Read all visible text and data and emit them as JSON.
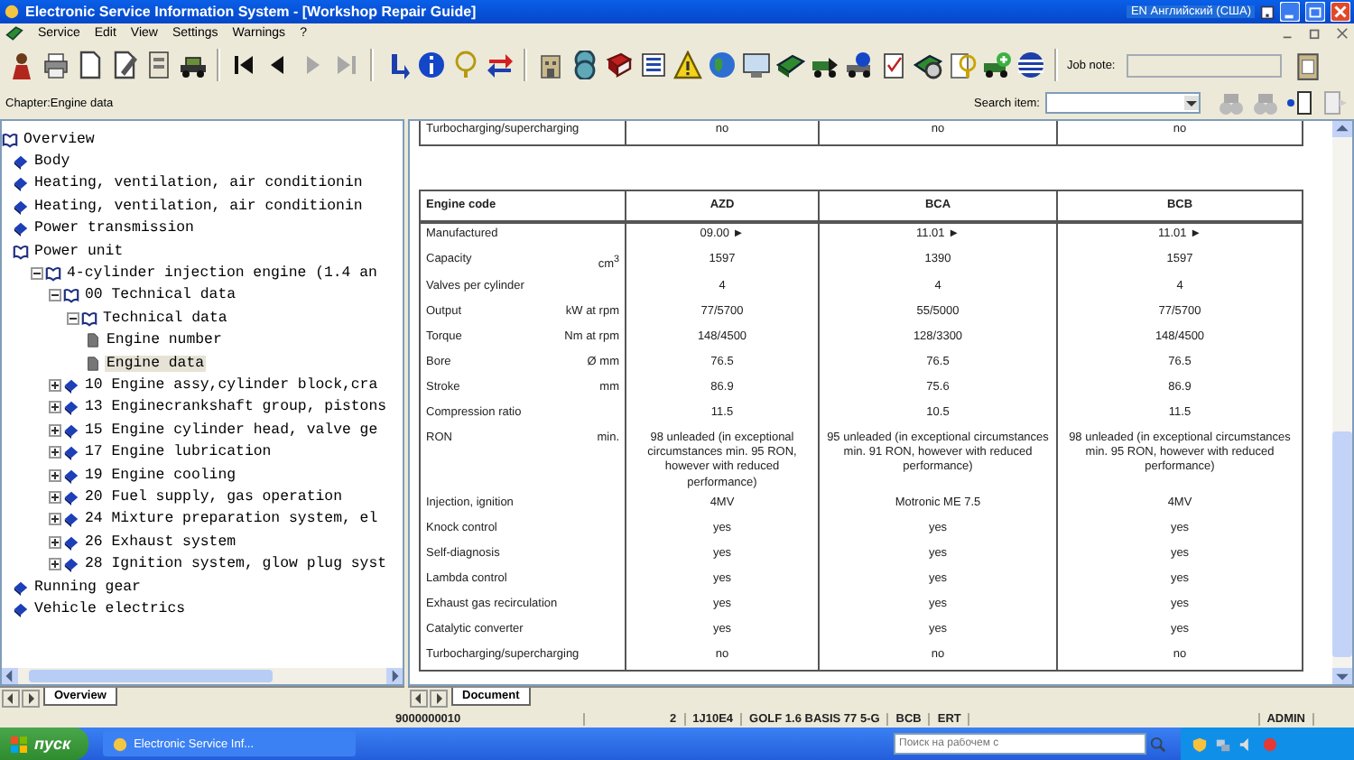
{
  "window": {
    "title": "Electronic Service Information System - [Workshop Repair Guide]",
    "language": "EN Английский (США)"
  },
  "menu": [
    "Service",
    "Edit",
    "View",
    "Settings",
    "Warnings",
    "?"
  ],
  "job_note": {
    "label": "Job note:"
  },
  "chapter": "Chapter:Engine data",
  "search": {
    "label": "Search item:"
  },
  "tree": [
    {
      "label": "Overview",
      "kind": "book",
      "expanded": true,
      "selected": false,
      "children": [
        {
          "label": "Body",
          "kind": "book",
          "selected": false
        },
        {
          "label": "Heating, ventilation, air conditionin",
          "kind": "book",
          "selected": false
        },
        {
          "label": "Heating, ventilation, air conditionin",
          "kind": "book",
          "selected": false
        },
        {
          "label": "Power transmission",
          "kind": "book",
          "selected": false
        },
        {
          "label": "Power unit",
          "kind": "book",
          "expanded": true,
          "selected": false,
          "children": [
            {
              "label": "4-cylinder injection engine (1.4 an",
              "kind": "book",
              "expanded": true,
              "selected": false,
              "children": [
                {
                  "label": "00 Technical data",
                  "kind": "book",
                  "expanded": true,
                  "selected": false,
                  "children": [
                    {
                      "label": "Technical data",
                      "kind": "book",
                      "expanded": true,
                      "selected": false,
                      "children": [
                        {
                          "label": "Engine number",
                          "kind": "page",
                          "selected": false
                        },
                        {
                          "label": "Engine data",
                          "kind": "page",
                          "selected": true
                        }
                      ]
                    }
                  ]
                },
                {
                  "label": "10 Engine assy,cylinder block,cra",
                  "kind": "book",
                  "expanded": false,
                  "selected": false
                },
                {
                  "label": "13 Enginecrankshaft group, pistons",
                  "kind": "book",
                  "expanded": false,
                  "selected": false
                },
                {
                  "label": "15 Engine cylinder head, valve ge",
                  "kind": "book",
                  "expanded": false,
                  "selected": false
                },
                {
                  "label": "17 Engine lubrication",
                  "kind": "book",
                  "expanded": false,
                  "selected": false
                },
                {
                  "label": "19 Engine cooling",
                  "kind": "book",
                  "expanded": false,
                  "selected": false
                },
                {
                  "label": "20 Fuel supply, gas operation",
                  "kind": "book",
                  "expanded": false,
                  "selected": false
                },
                {
                  "label": "24 Mixture preparation system, el",
                  "kind": "book",
                  "expanded": false,
                  "selected": false
                },
                {
                  "label": "26 Exhaust system",
                  "kind": "book",
                  "expanded": false,
                  "selected": false
                },
                {
                  "label": "28 Ignition system, glow plug syst",
                  "kind": "book",
                  "expanded": false,
                  "selected": false
                }
              ]
            }
          ]
        },
        {
          "label": "Running gear",
          "kind": "book",
          "selected": false
        },
        {
          "label": "Vehicle electrics",
          "kind": "book",
          "selected": false
        }
      ]
    }
  ],
  "previous_table_rows": [
    {
      "label": "Turbocharging/supercharging",
      "values": [
        "no",
        "no",
        "no"
      ]
    }
  ],
  "engine_table": {
    "columns": [
      "Engine code",
      "AZD",
      "BCA",
      "BCB"
    ],
    "rows": [
      {
        "label": "Manufactured",
        "values": [
          "09.00 ►",
          "11.01 ►",
          "11.01 ►"
        ]
      },
      {
        "label": "Capacity",
        "unit": "cm$^{3}$",
        "values": [
          "1597",
          "1390",
          "1597"
        ]
      },
      {
        "label": "Valves per cylinder",
        "values": [
          "4",
          "4",
          "4"
        ]
      },
      {
        "label": "Output",
        "unit": "kW at rpm",
        "values": [
          "77/5700",
          "55/5000",
          "77/5700"
        ]
      },
      {
        "label": "Torque",
        "unit": "Nm at rpm",
        "values": [
          "148/4500",
          "128/3300",
          "148/4500"
        ]
      },
      {
        "label": "Bore",
        "unit": "Ø mm",
        "values": [
          "76.5",
          "76.5",
          "76.5"
        ]
      },
      {
        "label": "Stroke",
        "unit": "mm",
        "values": [
          "86.9",
          "75.6",
          "86.9"
        ]
      },
      {
        "label": "Compression ratio",
        "values": [
          "11.5",
          "10.5",
          "11.5"
        ]
      },
      {
        "label": "RON",
        "unit": "min.",
        "values": [
          "98 unleaded (in exceptional circumstances min. 95 RON, however with reduced performance)",
          "95 unleaded (in exceptional circumstances min. 91 RON, however with reduced performance)",
          "98 unleaded (in exceptional circumstances min. 95 RON, however with reduced performance)"
        ]
      },
      {
        "label": "Injection, ignition",
        "values": [
          "4MV",
          "Motronic ME 7.5",
          "4MV"
        ]
      },
      {
        "label": "Knock control",
        "values": [
          "yes",
          "yes",
          "yes"
        ]
      },
      {
        "label": "Self-diagnosis",
        "values": [
          "yes",
          "yes",
          "yes"
        ]
      },
      {
        "label": "Lambda control",
        "values": [
          "yes",
          "yes",
          "yes"
        ]
      },
      {
        "label": "Exhaust gas recirculation",
        "values": [
          "yes",
          "yes",
          "yes"
        ]
      },
      {
        "label": "Catalytic converter",
        "values": [
          "yes",
          "yes",
          "yes"
        ]
      },
      {
        "label": "Turbocharging/supercharging",
        "values": [
          "no",
          "no",
          "no"
        ]
      }
    ]
  },
  "panel_tabs": {
    "left": "Overview",
    "right": "Document"
  },
  "status_bar": [
    "9000000010",
    "2",
    "1J10E4",
    "GOLF 1.6 BASIS 77 5-G",
    "BCB",
    "ERT",
    "ADMIN"
  ],
  "taskbar": {
    "start": "пуск",
    "task": "Electronic Service Inf...",
    "search_placeholder": "Поиск на рабочем с"
  }
}
